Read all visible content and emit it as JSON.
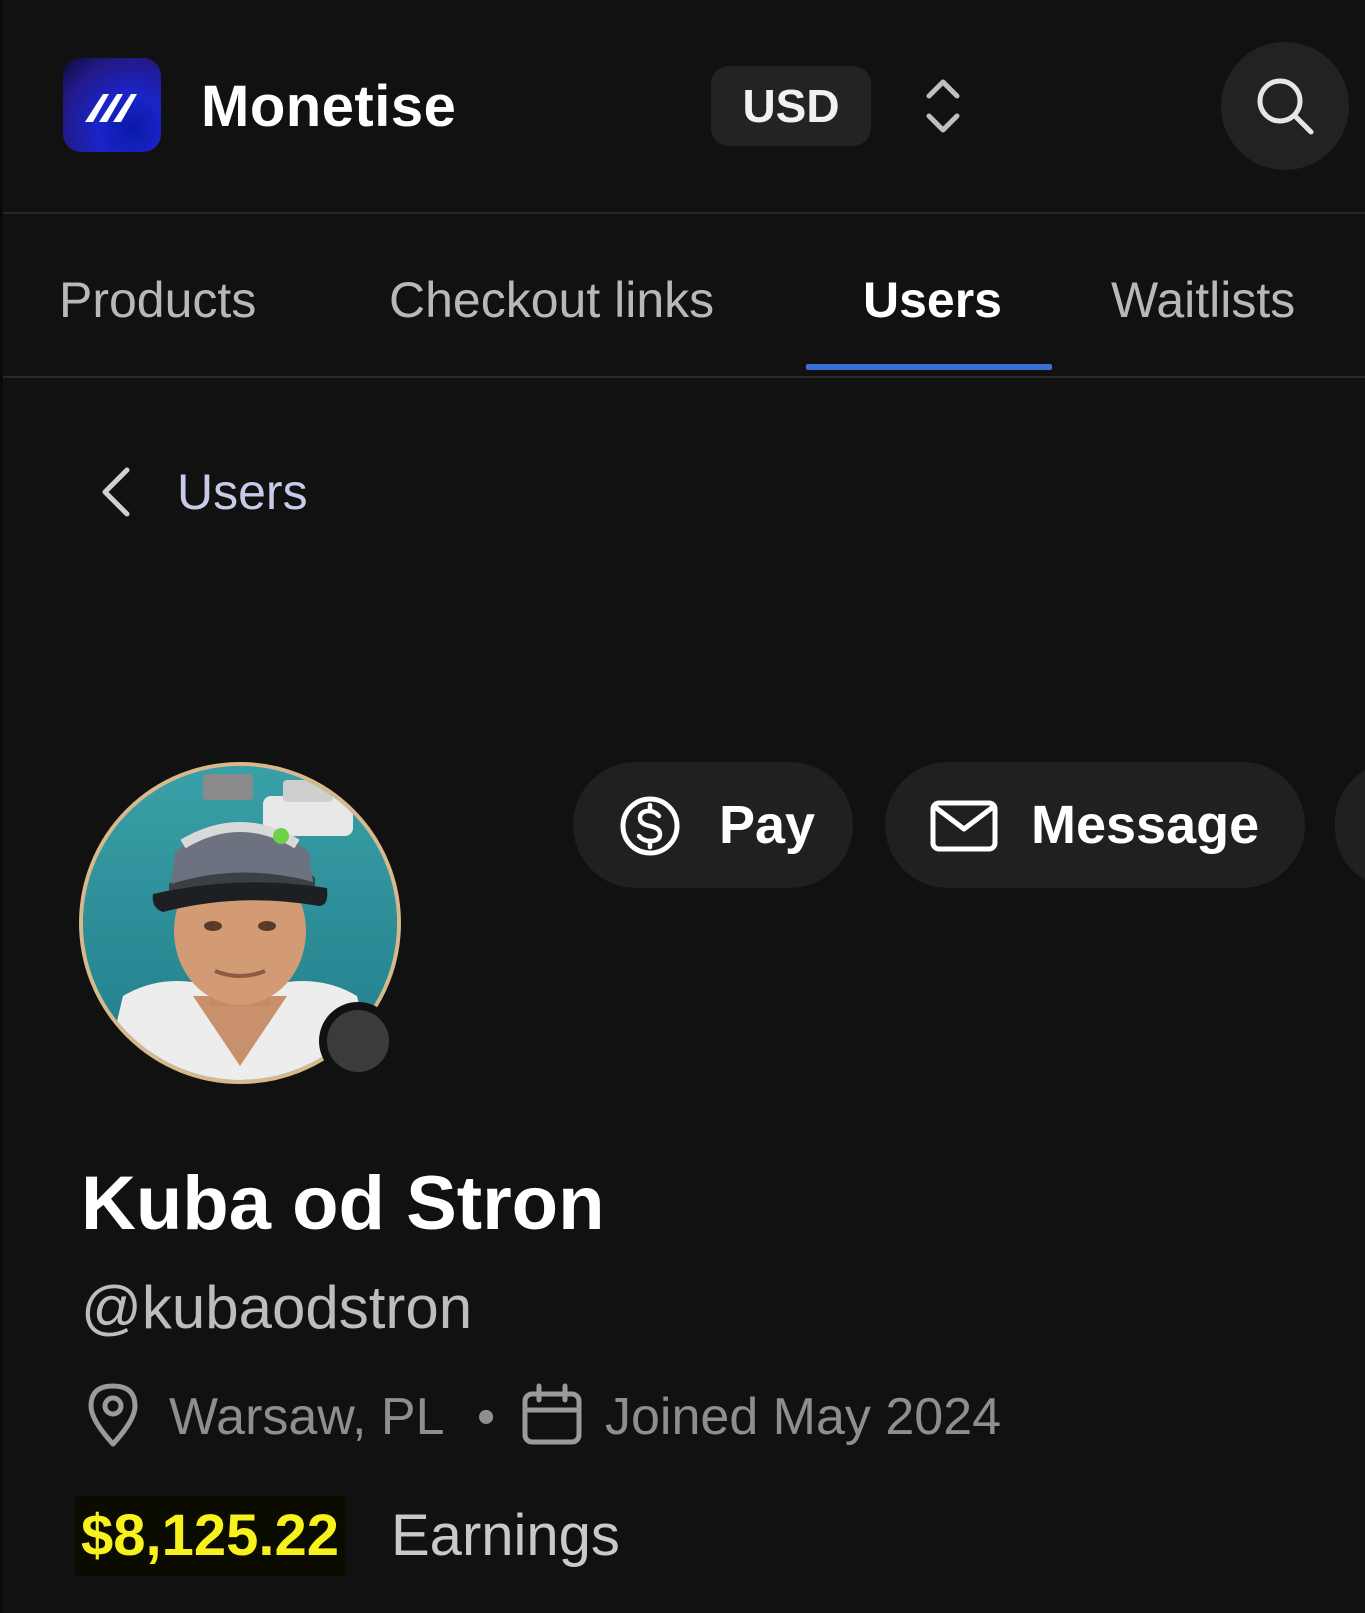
{
  "header": {
    "brand": "Monetise",
    "currency": "USD",
    "logo_icon": "monetise-logo-icon",
    "currency_toggle_icon": "chevron-up-down-icon",
    "search_icon": "search-icon"
  },
  "tabs": [
    {
      "label": "Products",
      "active": false
    },
    {
      "label": "Checkout links",
      "active": false
    },
    {
      "label": "Users",
      "active": true
    },
    {
      "label": "Waitlists",
      "active": false
    }
  ],
  "breadcrumb": {
    "back_label": "Users",
    "icon": "chevron-left-icon"
  },
  "actions": {
    "pay_label": "Pay",
    "pay_icon": "dollar-circle-icon",
    "message_label": "Message",
    "message_icon": "envelope-icon"
  },
  "profile": {
    "name": "Kuba od Stron",
    "handle": "@kubaodstron",
    "location": "Warsaw, PL",
    "separator": "•",
    "joined": "Joined May 2024",
    "earnings_amount": "$8,125.22",
    "earnings_label": "Earnings",
    "status": "offline"
  },
  "colors": {
    "background": "#111111",
    "accent_tab_underline": "#3d6fd8",
    "earnings_highlight": "#f7f11e",
    "avatar_ring": "#d7b98b"
  }
}
